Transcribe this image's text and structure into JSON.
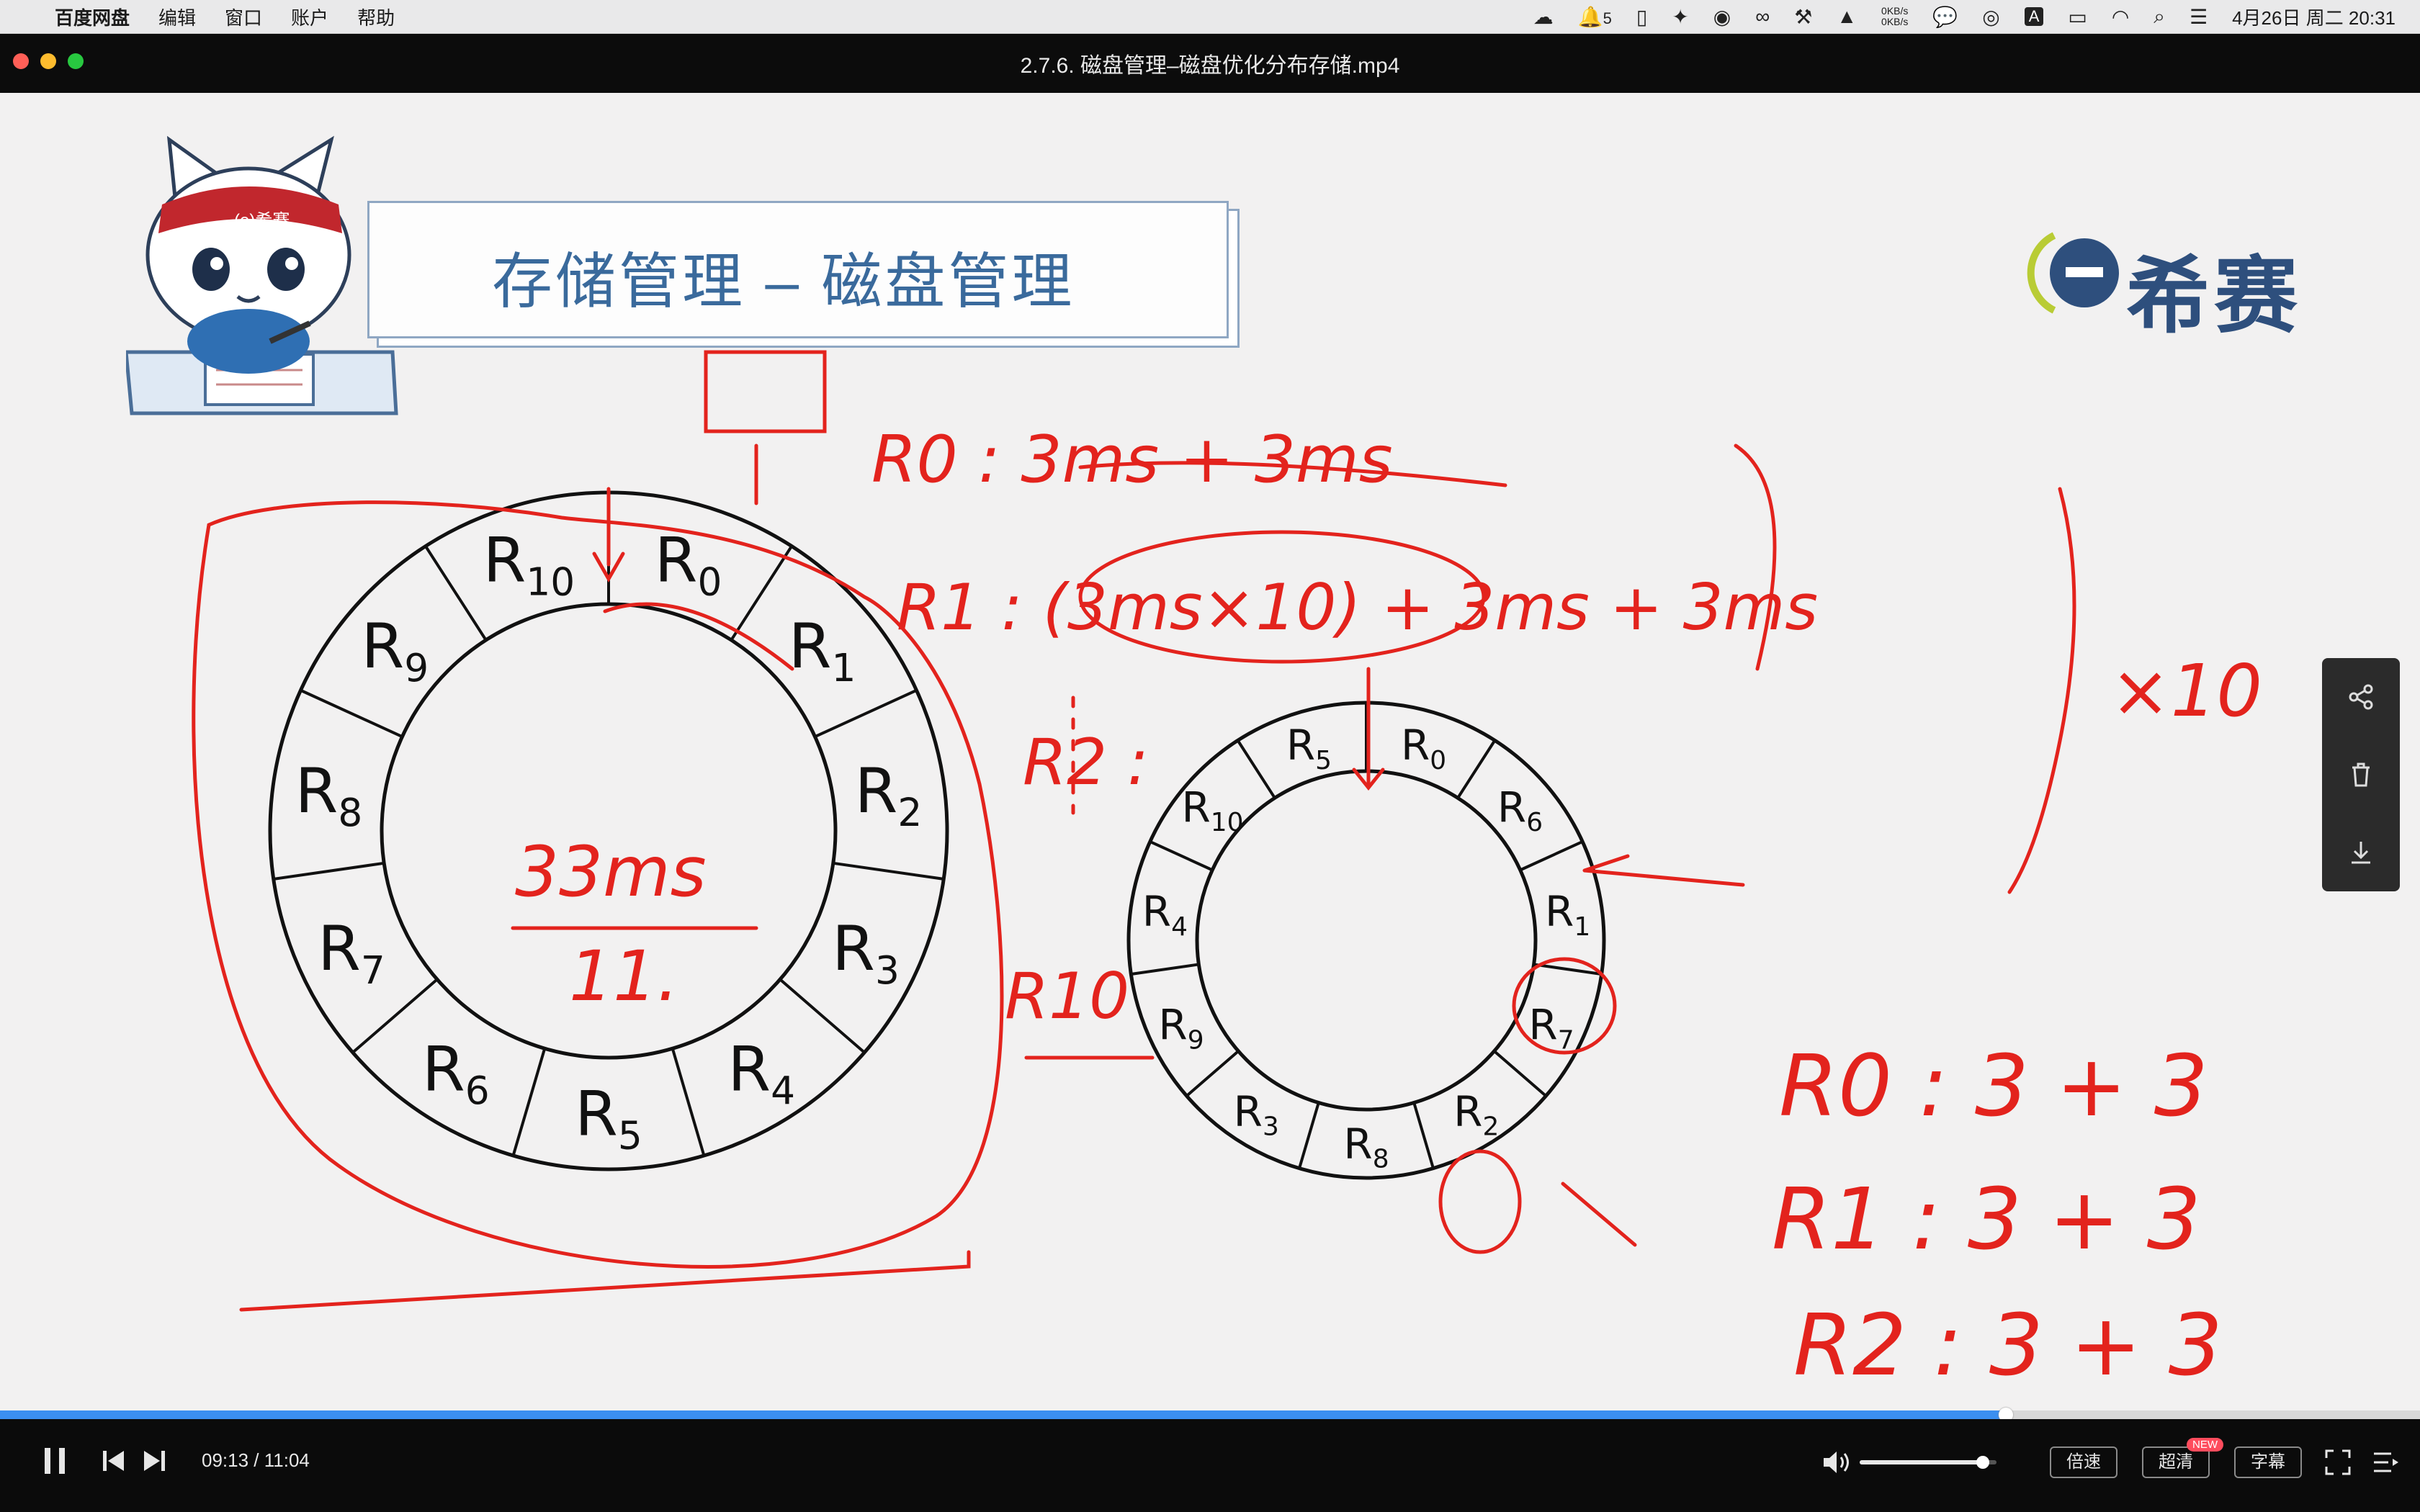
{
  "menubar": {
    "app_name": "百度网盘",
    "menus": [
      "编辑",
      "窗口",
      "账户",
      "帮助"
    ],
    "tray_badge": "5",
    "net_up": "0KB/s",
    "net_down": "0KB/s",
    "clock": "4月26日 周二  20:31"
  },
  "window": {
    "title": "2.7.6. 磁盘管理–磁盘优化分布存储.mp4"
  },
  "slide": {
    "title": "存储管理 – 磁盘管理",
    "brand": "希赛",
    "mascot_band": "(e)希赛"
  },
  "diagram": {
    "large_ring_labels": [
      "R0",
      "R1",
      "R2",
      "R3",
      "R4",
      "R5",
      "R6",
      "R7",
      "R8",
      "R9",
      "R10"
    ],
    "small_ring_labels": [
      "R0",
      "R6",
      "R1",
      "R7",
      "R2",
      "R8",
      "R3",
      "R9",
      "R4",
      "R10",
      "R5"
    ]
  },
  "annotations": {
    "r0_formula": "R0 :  3ms + 3ms",
    "r1_formula": "R1 :  (3ms×10) + 3ms + 3ms",
    "r2_label": "R2 :",
    "r10_label": "R10",
    "center_value": "33ms",
    "center_divisor": "11.",
    "times_ten": "×10",
    "list": [
      "R0 : 3 + 3",
      "R1 : 3 + 3",
      "R2 : 3 + 3"
    ]
  },
  "player": {
    "time": "09:13 / 11:04",
    "progress": 0.829,
    "volume": 0.9,
    "speed_label": "倍速",
    "quality_label": "超清",
    "quality_badge": "NEW",
    "subtitle_label": "字幕"
  },
  "colors": {
    "accent_blue": "#3b8ff0",
    "ink_red": "#e3231d",
    "title_blue": "#3a6a9c"
  }
}
